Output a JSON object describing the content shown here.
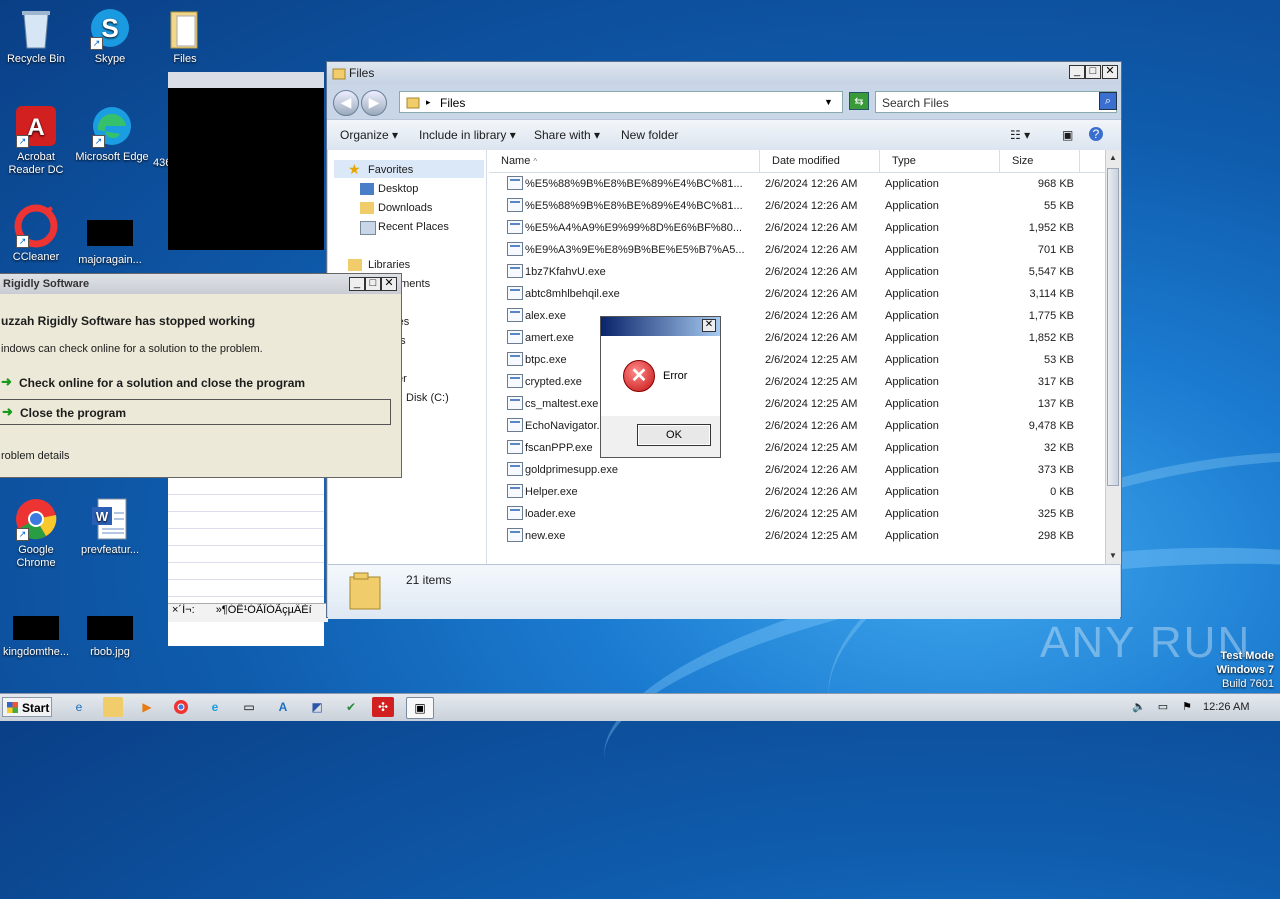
{
  "desktop": {
    "icons": [
      {
        "label": "Recycle Bin"
      },
      {
        "label": "Skype"
      },
      {
        "label": "Files"
      },
      {
        "label": "Acrobat Reader DC"
      },
      {
        "label": "Microsoft Edge"
      },
      {
        "label": "436"
      },
      {
        "label": "CCleaner"
      },
      {
        "label": "majoragain..."
      },
      {
        "label": "Google Chrome"
      },
      {
        "label": "prevfeatur..."
      },
      {
        "label": "kingdomthe..."
      },
      {
        "label": "rbob.jpg"
      }
    ],
    "background_window": {
      "status_left": "×´Ì¬:",
      "status_right": "»¶Ó­Ê¹ÓÃÎÒÃçµÄÈí"
    }
  },
  "explorer": {
    "title": "Files",
    "address": "Files",
    "search_placeholder": "Search Files",
    "toolbar": {
      "organize": "Organize",
      "include": "Include in library",
      "share": "Share with",
      "newfolder": "New folder"
    },
    "nav": {
      "favorites": "Favorites",
      "desktop": "Desktop",
      "downloads": "Downloads",
      "recent": "Recent Places",
      "libraries": "Libraries",
      "documents": "uments",
      "music": "c",
      "pictures": "res",
      "videos": "os",
      "computer": "ter",
      "disk": "Disk (C:)",
      "network": "k"
    },
    "columns": {
      "name": "Name",
      "date": "Date modified",
      "type": "Type",
      "size": "Size"
    },
    "files": [
      {
        "name": "%E5%88%9B%E8%BE%89%E4%BC%81...",
        "date": "2/6/2024 12:26 AM",
        "type": "Application",
        "size": "968 KB"
      },
      {
        "name": "%E5%88%9B%E8%BE%89%E4%BC%81...",
        "date": "2/6/2024 12:26 AM",
        "type": "Application",
        "size": "55 KB"
      },
      {
        "name": "%E5%A4%A9%E9%99%8D%E6%BF%80...",
        "date": "2/6/2024 12:26 AM",
        "type": "Application",
        "size": "1,952 KB"
      },
      {
        "name": "%E9%A3%9E%E8%9B%BE%E5%B7%A5...",
        "date": "2/6/2024 12:26 AM",
        "type": "Application",
        "size": "701 KB"
      },
      {
        "name": "1bz7KfahvU.exe",
        "date": "2/6/2024 12:26 AM",
        "type": "Application",
        "size": "5,547 KB"
      },
      {
        "name": "abtc8mhlbehqil.exe",
        "date": "2/6/2024 12:26 AM",
        "type": "Application",
        "size": "3,114 KB"
      },
      {
        "name": "alex.exe",
        "date": "2/6/2024 12:26 AM",
        "type": "Application",
        "size": "1,775 KB"
      },
      {
        "name": "amert.exe",
        "date": "2/6/2024 12:26 AM",
        "type": "Application",
        "size": "1,852 KB"
      },
      {
        "name": "btpc.exe",
        "date": "2/6/2024 12:25 AM",
        "type": "Application",
        "size": "53 KB"
      },
      {
        "name": "crypted.exe",
        "date": "2/6/2024 12:25 AM",
        "type": "Application",
        "size": "317 KB"
      },
      {
        "name": "cs_maltest.exe",
        "date": "2/6/2024 12:25 AM",
        "type": "Application",
        "size": "137 KB"
      },
      {
        "name": "EchoNavigator.",
        "date": "2/6/2024 12:26 AM",
        "type": "Application",
        "size": "9,478 KB"
      },
      {
        "name": "fscanPPP.exe",
        "date": "2/6/2024 12:25 AM",
        "type": "Application",
        "size": "32 KB"
      },
      {
        "name": "goldprimesupp.exe",
        "date": "2/6/2024 12:26 AM",
        "type": "Application",
        "size": "373 KB"
      },
      {
        "name": "Helper.exe",
        "date": "2/6/2024 12:26 AM",
        "type": "Application",
        "size": "0 KB"
      },
      {
        "name": "loader.exe",
        "date": "2/6/2024 12:25 AM",
        "type": "Application",
        "size": "325 KB"
      },
      {
        "name": "new.exe",
        "date": "2/6/2024 12:25 AM",
        "type": "Application",
        "size": "298 KB"
      }
    ],
    "item_count": "21 items"
  },
  "error_dialog": {
    "message": "Error",
    "ok": "OK"
  },
  "crash_dialog": {
    "title": "Rigidly Software",
    "headline": "uzzah Rigidly Software has stopped working",
    "sub": "indows can check online for a solution to the problem.",
    "option1": "Check online for a solution and close the program",
    "option2": "Close the program",
    "details": "roblem details"
  },
  "taskbar": {
    "start": "Start",
    "time": "12:26 AM"
  },
  "watermark": "ANY RUN",
  "testmode": {
    "line1": "Test Mode",
    "line2": "Windows 7",
    "line3": "Build 7601"
  }
}
